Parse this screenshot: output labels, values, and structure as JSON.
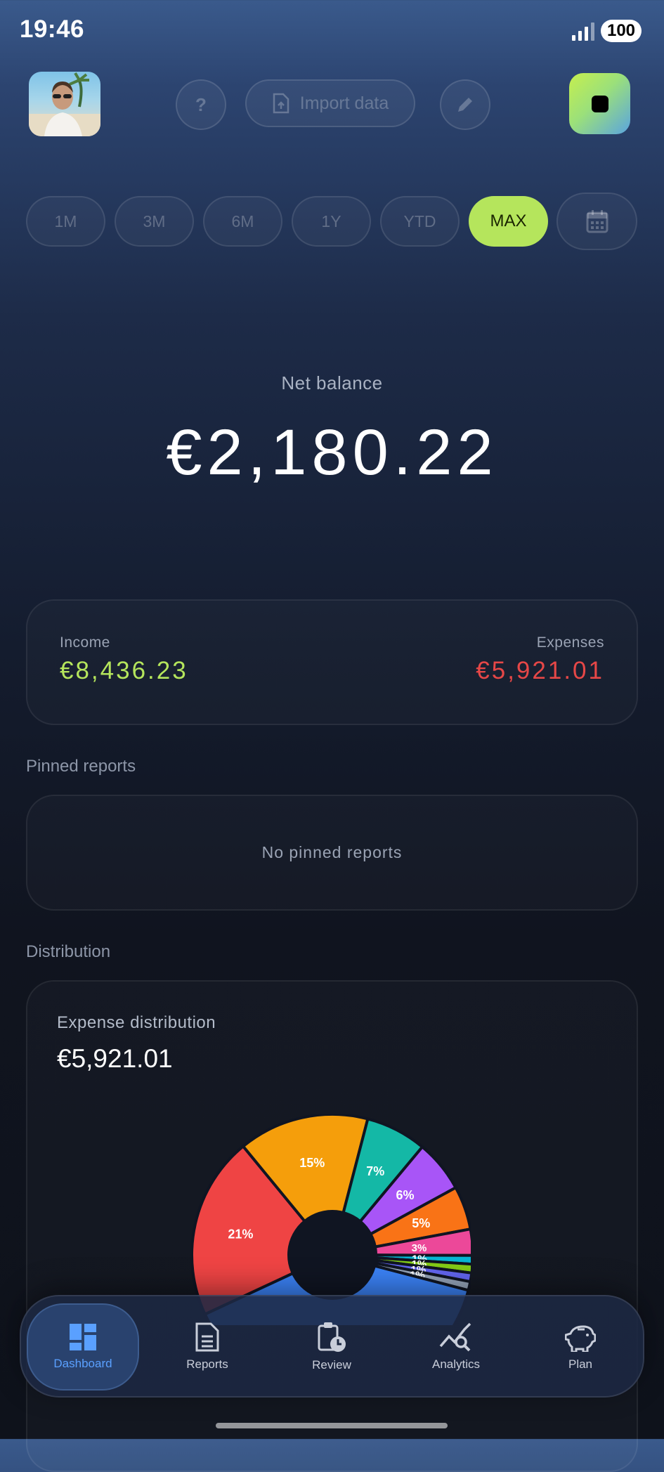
{
  "status_bar": {
    "time": "19:46",
    "battery": "100"
  },
  "header": {
    "help_label": "?",
    "import_label": "Import data",
    "avatar_icon": "user-avatar",
    "app_icon": "stop-icon"
  },
  "ranges": [
    "1M",
    "3M",
    "6M",
    "1Y",
    "YTD",
    "MAX"
  ],
  "active_range": "MAX",
  "balance": {
    "label": "Net balance",
    "value": "€2,180.22"
  },
  "summary": {
    "income_label": "Income",
    "income_value": "€8,436.23",
    "expenses_label": "Expenses",
    "expenses_value": "€5,921.01"
  },
  "pinned": {
    "title": "Pinned reports",
    "empty_text": "No pinned reports"
  },
  "distribution": {
    "title": "Distribution",
    "card_title": "Expense distribution",
    "card_value": "€5,921.01"
  },
  "chart_data": {
    "type": "pie",
    "values": [
      21,
      15,
      7,
      6,
      5,
      3,
      1,
      1,
      1,
      1,
      39
    ],
    "labels": [
      "21%",
      "15%",
      "7%",
      "6%",
      "5%",
      "3%",
      "1%",
      "1%",
      "1%",
      "1%",
      ""
    ],
    "colors": [
      "#ef4444",
      "#f59e0b",
      "#14b8a6",
      "#a855f7",
      "#f97316",
      "#ec4899",
      "#06b6d4",
      "#84cc16",
      "#6366f1",
      "#94a3b8",
      "#3b82f6"
    ]
  },
  "nav": {
    "items": [
      {
        "label": "Dashboard",
        "icon": "dashboard-icon"
      },
      {
        "label": "Reports",
        "icon": "document-icon"
      },
      {
        "label": "Review",
        "icon": "clipboard-clock-icon"
      },
      {
        "label": "Analytics",
        "icon": "chart-search-icon"
      },
      {
        "label": "Plan",
        "icon": "piggy-bank-icon"
      }
    ],
    "active": "Dashboard"
  },
  "colors": {
    "accent": "#b5e55c",
    "income": "#b5e55c",
    "expense": "#e64747",
    "nav_active": "#5aa0ff"
  }
}
